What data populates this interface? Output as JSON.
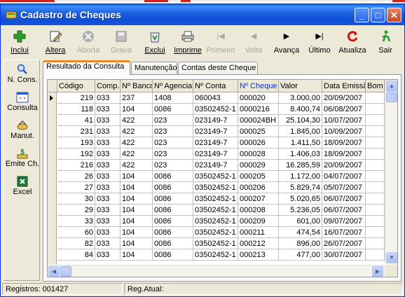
{
  "window": {
    "title": "Cadastro de Cheques"
  },
  "toolbar": {
    "items": [
      {
        "label": "Inclui",
        "icon": "plus-icon",
        "enabled": true
      },
      {
        "label": "Altera",
        "icon": "edit-icon",
        "enabled": true
      },
      {
        "label": "Aborta",
        "icon": "cancel-icon",
        "enabled": false
      },
      {
        "label": "Grava",
        "icon": "save-icon",
        "enabled": false
      },
      {
        "label": "Exclui",
        "icon": "recycle-bin-icon",
        "enabled": true
      },
      {
        "label": "Imprime",
        "icon": "printer-icon",
        "enabled": true
      },
      {
        "label": "Primeiro",
        "icon": "first-record-icon",
        "enabled": false
      },
      {
        "label": "Volta",
        "icon": "previous-record-icon",
        "enabled": false
      },
      {
        "label": "Avança",
        "icon": "next-record-icon",
        "enabled": true
      },
      {
        "label": "Último",
        "icon": "last-record-icon",
        "enabled": true
      },
      {
        "label": "Atualiza",
        "icon": "refresh-icon",
        "enabled": true
      },
      {
        "label": "Sair",
        "icon": "exit-icon",
        "enabled": true
      }
    ]
  },
  "sidebar": {
    "items": [
      {
        "label": "N. Cons.",
        "icon": "search-icon"
      },
      {
        "label": "Consulta",
        "icon": "window-icon"
      },
      {
        "label": "Manut.",
        "icon": "tools-icon"
      },
      {
        "label": "Emite Ch.",
        "icon": "money-icon"
      },
      {
        "label": "Excel",
        "icon": "excel-icon"
      }
    ]
  },
  "tabs": [
    {
      "label": "Resultado da Consulta",
      "active": true
    },
    {
      "label": "Manutenção",
      "active": false
    },
    {
      "label": "Contas deste Cheque",
      "active": false
    }
  ],
  "grid": {
    "columns": [
      "Código",
      "Comp.",
      "Nº Banco",
      "Nº Agencia",
      "Nº Conta",
      "Nº Cheque",
      "Valor",
      "Data Emissão",
      "Bom"
    ],
    "sorted_column": "Nº Cheque",
    "rows": [
      [
        "219",
        "033",
        "237",
        "1408",
        "060043",
        "000020",
        "3.000,00",
        "20/09/2007",
        ""
      ],
      [
        "118",
        "033",
        "104",
        "0086",
        "03502452-1",
        "0000216",
        "8.400,74",
        "06/08/2007",
        ""
      ],
      [
        "41",
        "033",
        "422",
        "023",
        "023149-7",
        "000024BH",
        "25.104,30",
        "10/07/2007",
        ""
      ],
      [
        "231",
        "033",
        "422",
        "023",
        "023149-7",
        "000025",
        "1.845,00",
        "10/09/2007",
        ""
      ],
      [
        "193",
        "033",
        "422",
        "023",
        "023149-7",
        "000026",
        "1.411,50",
        "18/09/2007",
        ""
      ],
      [
        "192",
        "033",
        "422",
        "023",
        "023149-7",
        "000028",
        "1.406,03",
        "18/09/2007",
        ""
      ],
      [
        "216",
        "033",
        "422",
        "023",
        "023149-7",
        "000029",
        "16.285,59",
        "20/09/2007",
        ""
      ],
      [
        "26",
        "033",
        "104",
        "0086",
        "03502452-1",
        "000205",
        "1.172,00",
        "04/07/2007",
        ""
      ],
      [
        "27",
        "033",
        "104",
        "0086",
        "03502452-1",
        "000206",
        "5.829,74",
        "05/07/2007",
        ""
      ],
      [
        "30",
        "033",
        "104",
        "0086",
        "03502452-1",
        "000207",
        "5.020,65",
        "06/07/2007",
        ""
      ],
      [
        "29",
        "033",
        "104",
        "0086",
        "03502452-1",
        "000208",
        "5.236,05",
        "06/07/2007",
        ""
      ],
      [
        "33",
        "033",
        "104",
        "0086",
        "03502452-1",
        "000209",
        "601,00",
        "09/07/2007",
        ""
      ],
      [
        "60",
        "033",
        "104",
        "0086",
        "03502452-1",
        "000211",
        "474,54",
        "16/07/2007",
        ""
      ],
      [
        "82",
        "033",
        "104",
        "0086",
        "03502452-1",
        "000212",
        "896,00",
        "26/07/2007",
        ""
      ],
      [
        "84",
        "033",
        "104",
        "0086",
        "03502452-1",
        "000213",
        "477,00",
        "30/07/2007",
        ""
      ]
    ]
  },
  "status": {
    "registros": "Registros: 001427",
    "reg_atual": "Reg.Atual:"
  }
}
